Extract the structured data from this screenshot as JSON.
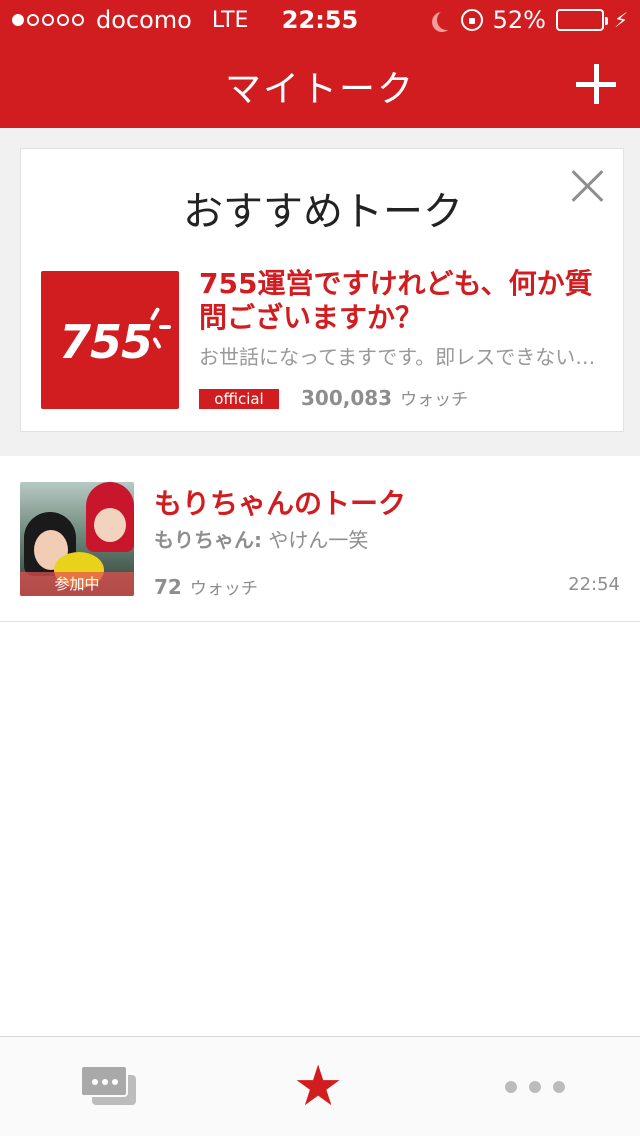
{
  "status_bar": {
    "signal_dots": 5,
    "signal_filled": 1,
    "carrier": "docomo",
    "network": "LTE",
    "time": "22:55",
    "battery": "52%",
    "battery_level": 0.52
  },
  "nav": {
    "title": "マイトーク"
  },
  "recommended": {
    "header": "おすすめトーク",
    "logo_text": "755",
    "talk_name": "755運営ですけれども、何か質問ございますか？",
    "description": "お世話になってますです。即レスできない…",
    "badge": "official",
    "watch_count": "300,083",
    "watch_label": "ウォッチ"
  },
  "talks": [
    {
      "name": "もりちゃんのトーク",
      "sender": "もりちゃん:",
      "last_message": "やけん一笑",
      "joined_label": "参加中",
      "watch_count": "72",
      "watch_label": "ウォッチ",
      "time": "22:54"
    }
  ],
  "tabbar": {
    "items": [
      {
        "icon": "chat-bubbles-icon",
        "active": false
      },
      {
        "icon": "star-icon",
        "active": true
      },
      {
        "icon": "more-icon",
        "active": false
      }
    ]
  },
  "colors": {
    "brand_red": "#d21d20",
    "battery_green": "#4cd964",
    "text_gray": "#8e8e8e"
  }
}
